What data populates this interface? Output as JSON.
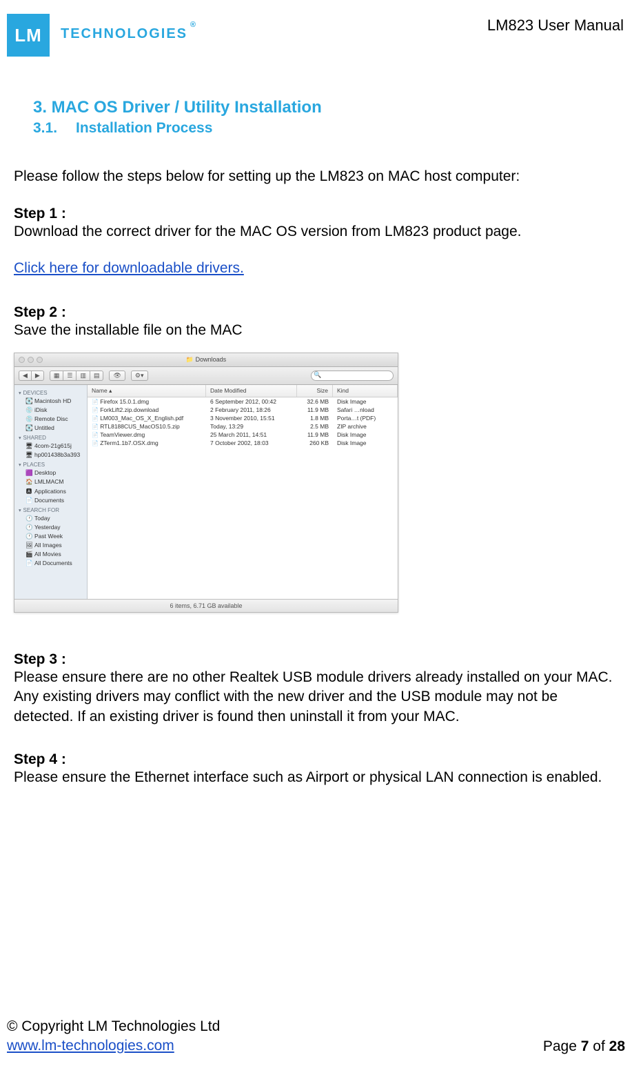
{
  "header": {
    "logo_initials": "LM",
    "logo_text": "TECHNOLOGIES",
    "reg_mark": "®",
    "doc_title": "LM823 User Manual"
  },
  "section": {
    "h1": "3.  MAC OS Driver / Utility Installation",
    "h2_num": "3.1.",
    "h2_text": "Installation Process"
  },
  "intro": "Please follow the steps below for setting up the LM823 on MAC host computer:",
  "step1": {
    "label": "Step 1 :",
    "body": "Download the correct driver for the MAC OS version from LM823 product page.",
    "link": "Click here for downloadable drivers."
  },
  "step2": {
    "label": "Step 2 :",
    "body": "Save the installable file on the MAC"
  },
  "finder": {
    "title": "Downloads",
    "columns": {
      "name": "Name",
      "date": "Date Modified",
      "size": "Size",
      "kind": "Kind"
    },
    "sort_indicator": "▴",
    "files": [
      {
        "name": "Firefox 15.0.1.dmg",
        "date": "6 September 2012, 00:42",
        "size": "32.6 MB",
        "kind": "Disk Image"
      },
      {
        "name": "ForkLift2.zip.download",
        "date": "2 February 2011, 18:26",
        "size": "11.9 MB",
        "kind": "Safari …nload"
      },
      {
        "name": "LM003_Mac_OS_X_English.pdf",
        "date": "3 November 2010, 15:51",
        "size": "1.8 MB",
        "kind": "Porta…t (PDF)"
      },
      {
        "name": "RTL8188CUS_MacOS10.5.zip",
        "date": "Today, 13:29",
        "size": "2.5 MB",
        "kind": "ZIP archive"
      },
      {
        "name": "TeamViewer.dmg",
        "date": "25 March 2011, 14:51",
        "size": "11.9 MB",
        "kind": "Disk Image"
      },
      {
        "name": "ZTerm1.1b7.OSX.dmg",
        "date": "7 October 2002, 18:03",
        "size": "260 KB",
        "kind": "Disk Image"
      }
    ],
    "sidebar": {
      "devices_label": "DEVICES",
      "devices": [
        "Macintosh HD",
        "iDisk",
        "Remote Disc",
        "Untitled"
      ],
      "shared_label": "SHARED",
      "shared": [
        "4com-21g615j",
        "hp001438b3a393"
      ],
      "places_label": "PLACES",
      "places": [
        "Desktop",
        "LMLMACM",
        "Applications",
        "Documents"
      ],
      "search_label": "SEARCH FOR",
      "search": [
        "Today",
        "Yesterday",
        "Past Week",
        "All Images",
        "All Movies",
        "All Documents"
      ]
    },
    "status": "6 items, 6.71 GB available"
  },
  "step3": {
    "label": "Step 3 :",
    "body": "Please ensure there are no other Realtek USB module drivers already installed on your MAC. Any existing drivers may conflict with the new driver and the USB module may not be detected. If an existing driver is found then uninstall it from your MAC."
  },
  "step4": {
    "label": "Step 4 :",
    "body": "Please ensure the Ethernet interface such as Airport or physical LAN connection is enabled."
  },
  "footer": {
    "copyright": "© Copyright LM Technologies Ltd",
    "url": "www.lm-technologies.com",
    "page_prefix": "Page ",
    "page_current": "7",
    "page_sep": " of ",
    "page_total": "28"
  }
}
